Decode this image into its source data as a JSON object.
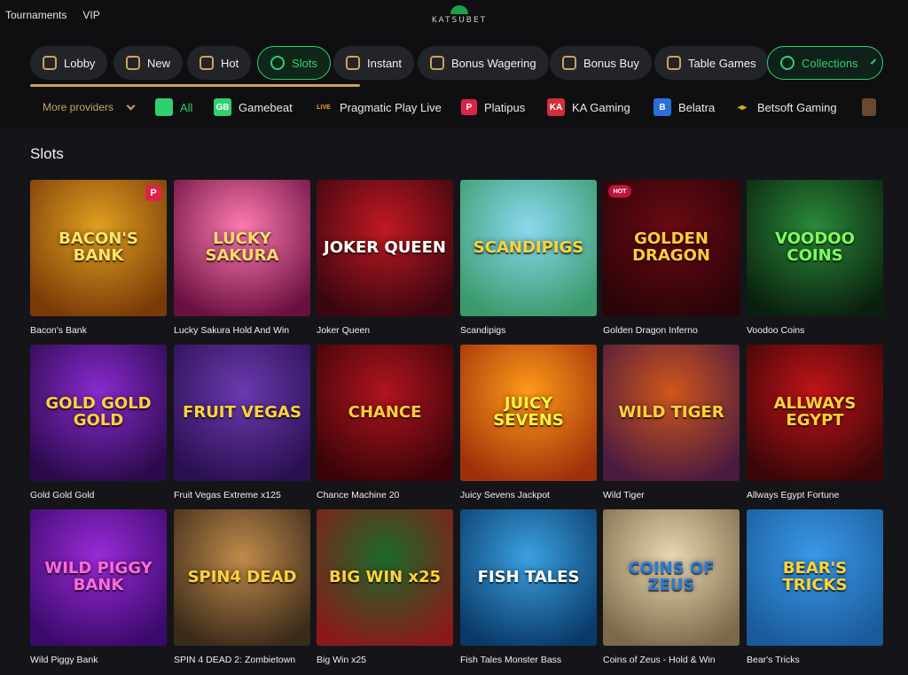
{
  "header": {
    "links": [
      "Tournaments",
      "VIP"
    ],
    "logo_text": "KATSUBET"
  },
  "categories": [
    {
      "label": "Lobby",
      "icon": "lobby-icon"
    },
    {
      "label": "New",
      "icon": "new-icon"
    },
    {
      "label": "Hot",
      "icon": "fire-icon"
    },
    {
      "label": "Slots",
      "icon": "cherry-icon",
      "active": true
    },
    {
      "label": "Instant",
      "icon": "rocket-icon"
    },
    {
      "label": "Bonus Wagering",
      "icon": "target-icon"
    },
    {
      "label": "Bonus Buy",
      "icon": "gift-icon"
    },
    {
      "label": "Table Games",
      "icon": "chip-icon"
    },
    {
      "label": "Collections",
      "icon": "collections-icon"
    }
  ],
  "providers": {
    "more_label": "More providers",
    "items": [
      {
        "label": "All",
        "logo": "GB",
        "color": "#2fd06e"
      },
      {
        "label": "Gamebeat",
        "logo": "GB",
        "color": "#2fd06e"
      },
      {
        "label": "Pragmatic Play Live",
        "logo": "LIVE",
        "color": "#f2a12a"
      },
      {
        "label": "Platipus",
        "logo": "P",
        "color": "#e0224a"
      },
      {
        "label": "KA Gaming",
        "logo": "KA",
        "color": "#d32f3a"
      },
      {
        "label": "Belatra",
        "logo": "B",
        "color": "#2a6fdb"
      },
      {
        "label": "Betsoft Gaming",
        "logo": "◂▸",
        "color": "#d8b000"
      }
    ]
  },
  "section": {
    "title": "Slots"
  },
  "games": [
    {
      "name": "Bacon's Bank",
      "art": "BACON'S BANK",
      "bg": [
        "#e0a020",
        "#7a3a08"
      ],
      "fg": "#ffe36a",
      "badge": "P"
    },
    {
      "name": "Lucky Sakura Hold And Win",
      "art": "LUCKY SAKURA",
      "bg": [
        "#ff7bb0",
        "#6a1040"
      ],
      "fg": "#ffd86a"
    },
    {
      "name": "Joker Queen",
      "art": "JOKER QUEEN",
      "bg": [
        "#c01822",
        "#3a0610"
      ],
      "fg": "#ffffff"
    },
    {
      "name": "Scandipigs",
      "art": "SCANDIPIGS",
      "bg": [
        "#8ad8f0",
        "#3a9a6a"
      ],
      "fg": "#ffd23a"
    },
    {
      "name": "Golden Dragon Inferno",
      "art": "GOLDEN DRAGON",
      "bg": [
        "#6a0a12",
        "#2a0408"
      ],
      "fg": "#ffcc3a",
      "badge": "HOT"
    },
    {
      "name": "Voodoo Coins",
      "art": "VOODOO COINS",
      "bg": [
        "#2a8a3a",
        "#0a200e"
      ],
      "fg": "#7dff5a"
    },
    {
      "name": "Gold Gold Gold",
      "art": "GOLD GOLD GOLD",
      "bg": [
        "#8a2ad0",
        "#2a0a4a"
      ],
      "fg": "#ffd23a"
    },
    {
      "name": "Fruit Vegas Extreme x125",
      "art": "FRUIT VEGAS",
      "bg": [
        "#6a3ab0",
        "#2a1050"
      ],
      "fg": "#ffd23a"
    },
    {
      "name": "Chance Machine 20",
      "art": "CHANCE",
      "bg": [
        "#b0141e",
        "#3a0408"
      ],
      "fg": "#ffcc3a"
    },
    {
      "name": "Juicy Sevens Jackpot",
      "art": "JUICY SEVENS",
      "bg": [
        "#ff9a1a",
        "#a0300a"
      ],
      "fg": "#fff23a"
    },
    {
      "name": "Wild Tiger",
      "art": "WILD TIGER",
      "bg": [
        "#d0561a",
        "#4a1a40"
      ],
      "fg": "#ffd23a"
    },
    {
      "name": "Allways Egypt Fortune",
      "art": "ALLWAYS EGYPT",
      "bg": [
        "#c01418",
        "#3a0608"
      ],
      "fg": "#ffd23a"
    },
    {
      "name": "Wild Piggy Bank",
      "art": "WILD PIGGY BANK",
      "bg": [
        "#9a2ad8",
        "#3a0a6a"
      ],
      "fg": "#ff6ad8"
    },
    {
      "name": "SPIN 4 DEAD 2: Zombietown",
      "art": "SPIN4 DEAD",
      "bg": [
        "#c08a4a",
        "#3a2a1a"
      ],
      "fg": "#ffd23a"
    },
    {
      "name": "Big Win x25",
      "art": "BIG WIN x25",
      "bg": [
        "#1a6a2a",
        "#8a1a1a"
      ],
      "fg": "#ffd23a"
    },
    {
      "name": "Fish Tales Monster Bass",
      "art": "FISH TALES",
      "bg": [
        "#3aa0e0",
        "#0a3a6a"
      ],
      "fg": "#ffffff"
    },
    {
      "name": "Coins of Zeus - Hold & Win",
      "art": "COINS OF ZEUS",
      "bg": [
        "#e8d8b0",
        "#7a6a4a"
      ],
      "fg": "#2a7ad8"
    },
    {
      "name": "Bear's Tricks",
      "art": "BEAR'S TRICKS",
      "bg": [
        "#3a9ae8",
        "#1a5a9a"
      ],
      "fg": "#ffd23a"
    }
  ]
}
